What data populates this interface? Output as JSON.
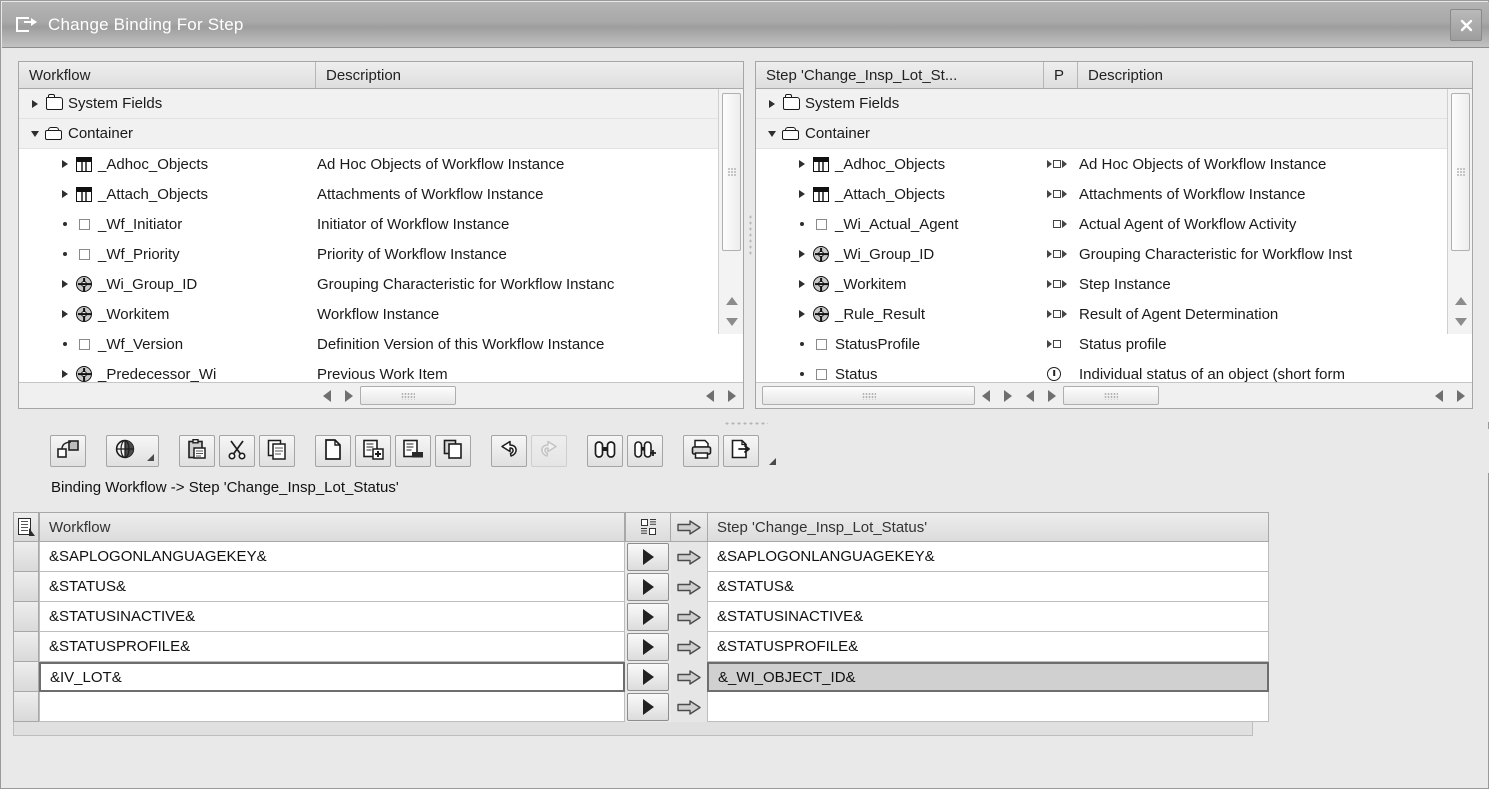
{
  "window": {
    "title": "Change Binding For Step",
    "title_icon": "binding-icon",
    "close_label": "✕"
  },
  "left_pane": {
    "columns": [
      {
        "label": "Workflow"
      },
      {
        "label": "Description"
      }
    ],
    "rows": [
      {
        "indent": 0,
        "expander": "collapsed",
        "icon": "folder-closed-icon",
        "name": "System Fields",
        "desc": "",
        "group": true
      },
      {
        "indent": 0,
        "expander": "expanded",
        "icon": "folder-open-icon",
        "name": "Container",
        "desc": "",
        "group": true
      },
      {
        "indent": 1,
        "expander": "collapsed",
        "icon": "table-icon",
        "name": "_Adhoc_Objects",
        "desc": "Ad Hoc Objects of Workflow Instance"
      },
      {
        "indent": 1,
        "expander": "collapsed",
        "icon": "table-icon",
        "name": "_Attach_Objects",
        "desc": "Attachments of Workflow Instance"
      },
      {
        "indent": 1,
        "expander": "leaf",
        "icon": "element-icon",
        "name": "_Wf_Initiator",
        "desc": "Initiator of Workflow Instance"
      },
      {
        "indent": 1,
        "expander": "leaf",
        "icon": "element-icon",
        "name": "_Wf_Priority",
        "desc": "Priority of Workflow Instance"
      },
      {
        "indent": 1,
        "expander": "collapsed",
        "icon": "object-icon",
        "name": "_Wi_Group_ID",
        "desc": "Grouping Characteristic for Workflow Instanc"
      },
      {
        "indent": 1,
        "expander": "collapsed",
        "icon": "object-icon",
        "name": "_Workitem",
        "desc": "Workflow Instance"
      },
      {
        "indent": 1,
        "expander": "leaf",
        "icon": "element-icon",
        "name": "_Wf_Version",
        "desc": "Definition Version of this Workflow Instance"
      },
      {
        "indent": 1,
        "expander": "collapsed",
        "icon": "object-icon",
        "name": "_Predecessor_Wi",
        "desc": "Previous Work Item"
      }
    ]
  },
  "right_pane": {
    "columns": [
      {
        "label": "Step 'Change_Insp_Lot_St..."
      },
      {
        "label": "P"
      },
      {
        "label": "Description"
      }
    ],
    "rows": [
      {
        "indent": 0,
        "expander": "collapsed",
        "icon": "folder-closed-icon",
        "name": "System Fields",
        "p": "",
        "desc": "",
        "group": true
      },
      {
        "indent": 0,
        "expander": "expanded",
        "icon": "folder-open-icon",
        "name": "Container",
        "p": "",
        "desc": "",
        "group": true
      },
      {
        "indent": 1,
        "expander": "collapsed",
        "icon": "table-icon",
        "name": "_Adhoc_Objects",
        "p": "in-out",
        "desc": "Ad Hoc Objects of Workflow Instance"
      },
      {
        "indent": 1,
        "expander": "collapsed",
        "icon": "table-icon",
        "name": "_Attach_Objects",
        "p": "in-out",
        "desc": "Attachments of Workflow Instance"
      },
      {
        "indent": 1,
        "expander": "leaf",
        "icon": "element-icon",
        "name": "_Wi_Actual_Agent",
        "p": "out",
        "desc": "Actual Agent of Workflow Activity"
      },
      {
        "indent": 1,
        "expander": "collapsed",
        "icon": "object-icon",
        "name": "_Wi_Group_ID",
        "p": "in-out",
        "desc": "Grouping Characteristic for Workflow Inst"
      },
      {
        "indent": 1,
        "expander": "collapsed",
        "icon": "object-icon",
        "name": "_Workitem",
        "p": "in-out",
        "desc": "Step Instance"
      },
      {
        "indent": 1,
        "expander": "collapsed",
        "icon": "object-icon",
        "name": "_Rule_Result",
        "p": "in-out",
        "desc": "Result of Agent Determination"
      },
      {
        "indent": 1,
        "expander": "leaf",
        "icon": "element-icon",
        "name": "StatusProfile",
        "p": "in",
        "desc": "Status profile"
      },
      {
        "indent": 1,
        "expander": "leaf",
        "icon": "element-icon",
        "name": "Status",
        "p": "status",
        "desc": "Individual status of an object (short form"
      }
    ]
  },
  "toolbar": {
    "buttons": [
      {
        "name": "binding-icon",
        "tooltip": "Binding"
      },
      {
        "name": "globe-icon",
        "tooltip": "Namespace",
        "dropdown": true
      },
      {
        "name": "paste-icon",
        "tooltip": "Paste"
      },
      {
        "name": "cut-icon",
        "tooltip": "Cut"
      },
      {
        "name": "copy-icon",
        "tooltip": "Copy"
      },
      {
        "name": "new-document-icon",
        "tooltip": "New"
      },
      {
        "name": "insert-row-icon",
        "tooltip": "Insert"
      },
      {
        "name": "delete-row-icon",
        "tooltip": "Delete"
      },
      {
        "name": "duplicate-icon",
        "tooltip": "Duplicate"
      },
      {
        "name": "undo-icon",
        "tooltip": "Undo"
      },
      {
        "name": "redo-icon",
        "tooltip": "Redo",
        "disabled": true
      },
      {
        "name": "find-icon",
        "tooltip": "Find"
      },
      {
        "name": "find-next-icon",
        "tooltip": "Find Next"
      },
      {
        "name": "print-icon",
        "tooltip": "Print"
      },
      {
        "name": "export-icon",
        "tooltip": "Export",
        "dropdown": true
      }
    ]
  },
  "binding": {
    "header_text": "Binding Workflow  -> Step 'Change_Insp_Lot_Status'",
    "col_left_label": "Workflow",
    "col_right_label": "Step 'Change_Insp_Lot_Status'",
    "rows": [
      {
        "left": "&SAPLOGONLANGUAGEKEY&",
        "right": "&SAPLOGONLANGUAGEKEY&",
        "selected": false
      },
      {
        "left": "&STATUS&",
        "right": "&STATUS&",
        "selected": false
      },
      {
        "left": "&STATUSINACTIVE&",
        "right": "&STATUSINACTIVE&",
        "selected": false
      },
      {
        "left": "&STATUSPROFILE&",
        "right": "&STATUSPROFILE&",
        "selected": false
      },
      {
        "left": "&IV_LOT&",
        "right": "&_WI_OBJECT_ID&",
        "selected": true
      },
      {
        "left": "",
        "right": "",
        "selected": false
      }
    ]
  }
}
